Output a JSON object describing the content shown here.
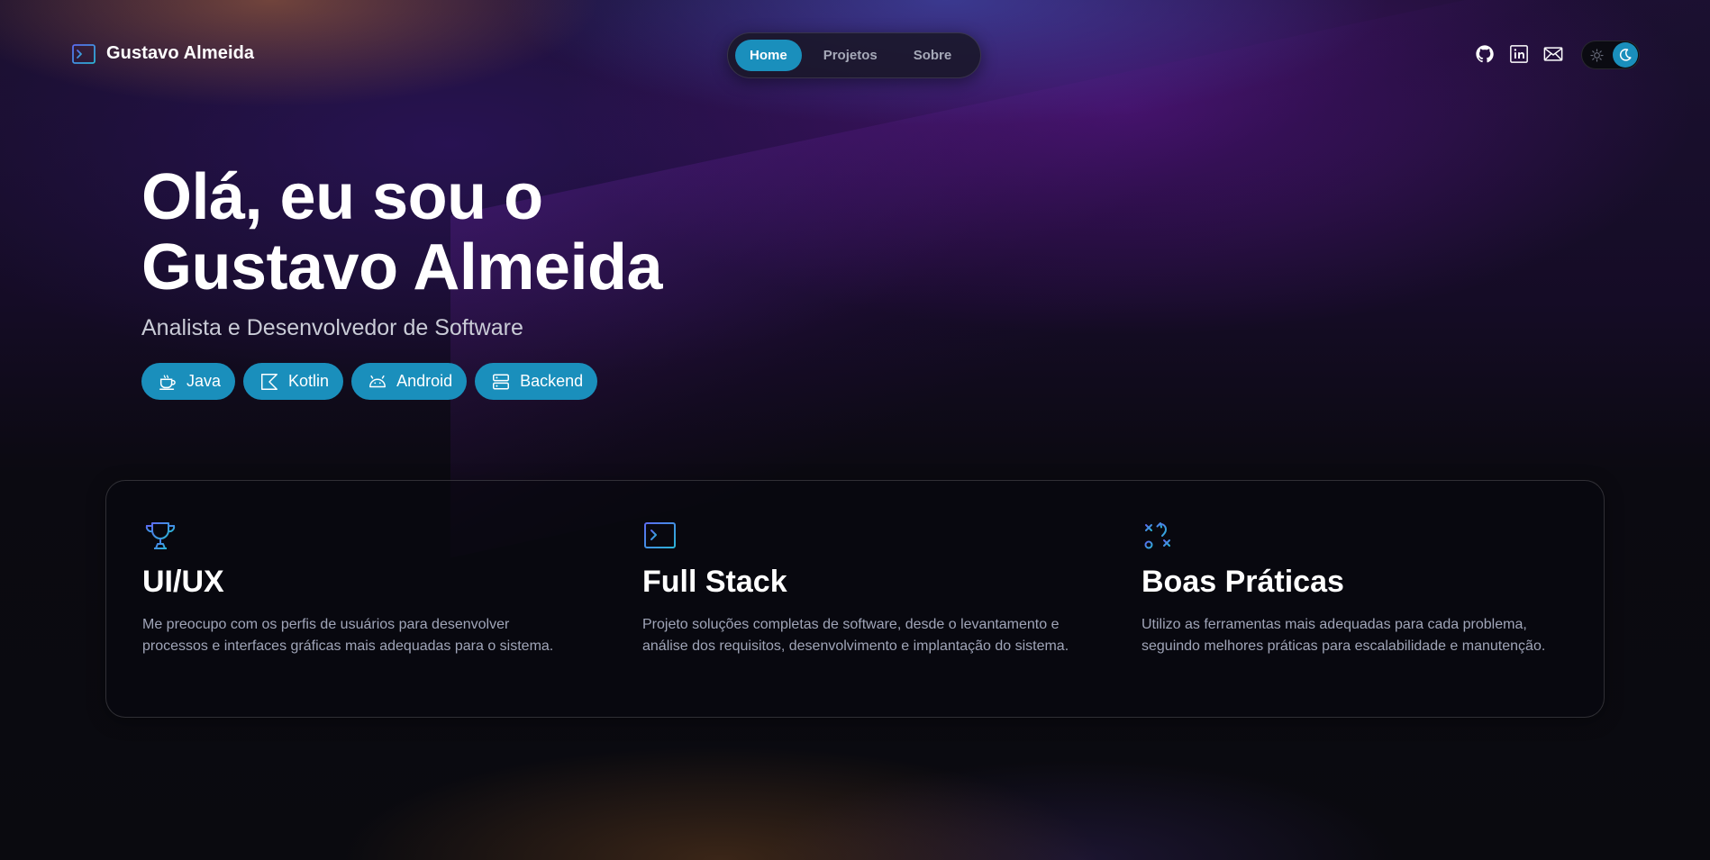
{
  "header": {
    "brand_name": "Gustavo Almeida",
    "brand_icon": "terminal-icon",
    "nav": [
      {
        "label": "Home",
        "active": true
      },
      {
        "label": "Projetos",
        "active": false
      },
      {
        "label": "Sobre",
        "active": false
      }
    ],
    "socials": [
      "github-icon",
      "linkedin-icon",
      "mail-icon"
    ],
    "theme_toggle": {
      "mode": "dark",
      "icons": [
        "sun-icon",
        "moon-icon"
      ]
    }
  },
  "hero": {
    "title_line1": "Olá, eu sou o",
    "title_line2": "Gustavo Almeida",
    "subtitle": "Analista e Desenvolvedor de Software",
    "chips": [
      {
        "label": "Java",
        "icon": "coffee-cup-icon"
      },
      {
        "label": "Kotlin",
        "icon": "kotlin-icon"
      },
      {
        "label": "Android",
        "icon": "android-icon"
      },
      {
        "label": "Backend",
        "icon": "server-icon"
      }
    ]
  },
  "features": [
    {
      "icon": "trophy-icon",
      "title": "UI/UX",
      "description": "Me preocupo com os perfis de usuários para desenvolver processos e interfaces gráficas mais adequadas para o sistema."
    },
    {
      "icon": "terminal-icon",
      "title": "Full Stack",
      "description": "Projeto soluções completas de software, desde o levantamento e análise dos requisitos, desenvolvimento e implantação do sistema."
    },
    {
      "icon": "strategy-icon",
      "title": "Boas Práticas",
      "description": "Utilizo as ferramentas mais adequadas para cada problema, seguindo melhores práticas para escalabilidade e manutenção."
    }
  ],
  "colors": {
    "accent": "#1a8fbc",
    "background": "#0a0a0f",
    "muted_text": "#a0a5b8",
    "icon_gradient_start": "#5b6cf0",
    "icon_gradient_end": "#2bb3d6"
  }
}
